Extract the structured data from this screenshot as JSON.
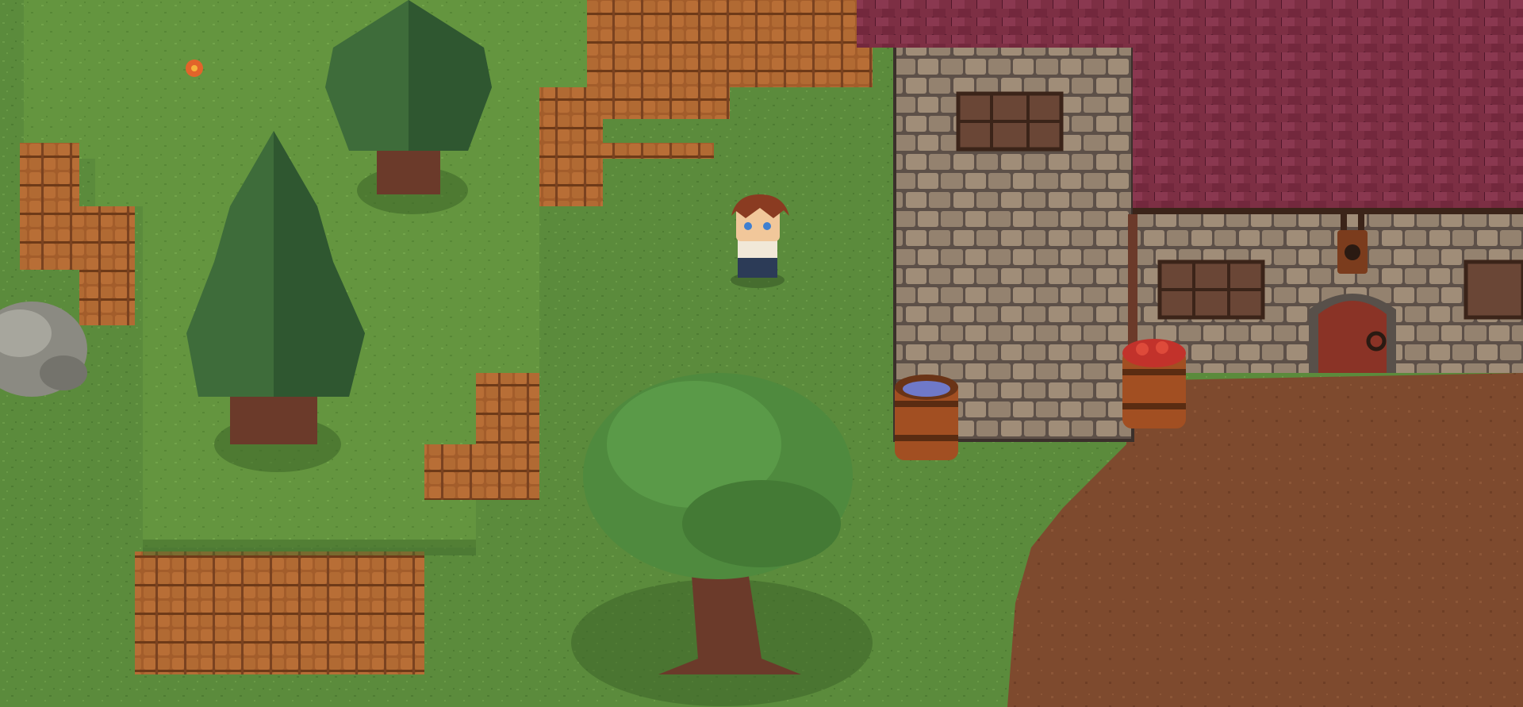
{
  "scene": {
    "palette": {
      "grass": "#5b8b3c",
      "grass_dark": "#4a7530",
      "grass_raised": "#6a9a44",
      "cliff": "#a9602d",
      "cliff_dark": "#6e3a18",
      "dirt": "#7e4a2e",
      "stone": "#9c8b78",
      "stone_dark": "#5d5048",
      "roof": "#7d2f44",
      "roof_dark": "#51182b",
      "pine": "#3e6c3a",
      "pine_dark": "#1f3d22",
      "oak": "#4f8a3e",
      "trunk": "#6b3a2a",
      "door": "#8a3326",
      "water": "#6f79c9",
      "apple": "#c2322b"
    },
    "icons": [
      "player-character",
      "pine-tree",
      "oak-tree",
      "stone-tower",
      "cottage",
      "water-barrel",
      "apple-barrel",
      "wooden-door",
      "hanging-lantern",
      "boulder",
      "flower"
    ]
  }
}
